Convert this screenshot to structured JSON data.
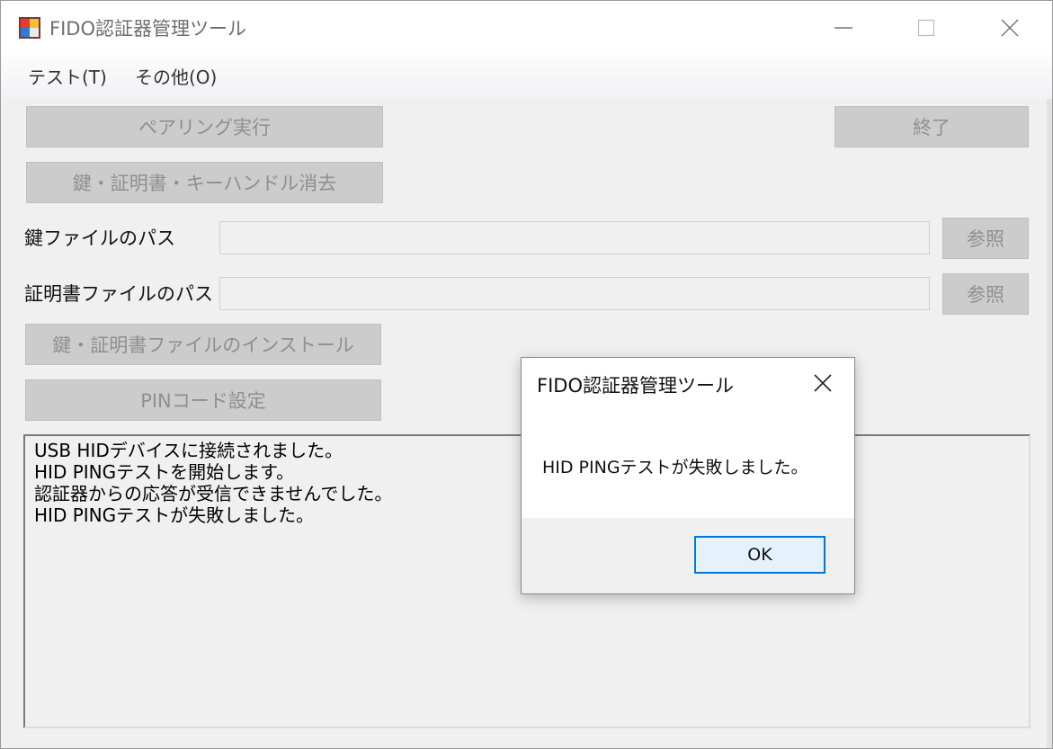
{
  "window": {
    "title": "FIDO認証器管理ツール"
  },
  "menu": {
    "items": [
      "テスト(T)",
      "その他(O)"
    ]
  },
  "buttons": {
    "pairing": "ペアリング実行",
    "exit": "終了",
    "erase": "鍵・証明書・キーハンドル消去",
    "browse_key": "参照",
    "browse_cert": "参照",
    "install": "鍵・証明書ファイルのインストール",
    "pin": "PINコード設定"
  },
  "fields": {
    "key_path_label": "鍵ファイルのパス",
    "key_path_value": "",
    "cert_path_label": "証明書ファイルのパス",
    "cert_path_value": ""
  },
  "log": {
    "lines": [
      "USB HIDデバイスに接続されました。",
      "HID PINGテストを開始します。",
      "認証器からの応答が受信できませんでした。",
      "HID PINGテストが失敗しました。"
    ]
  },
  "dialog": {
    "title": "FIDO認証器管理ツール",
    "message": "HID PINGテストが失敗しました。",
    "ok_label": "OK"
  },
  "icons": {
    "app": "app-icon",
    "minimize": "minimize-icon",
    "maximize": "maximize-icon",
    "close": "close-icon"
  },
  "colors": {
    "disabled_button_bg": "#cccccc",
    "disabled_text": "#8f8f8f",
    "focus_accent": "#0078d7",
    "ok_button_bg": "#e5f1fb"
  }
}
